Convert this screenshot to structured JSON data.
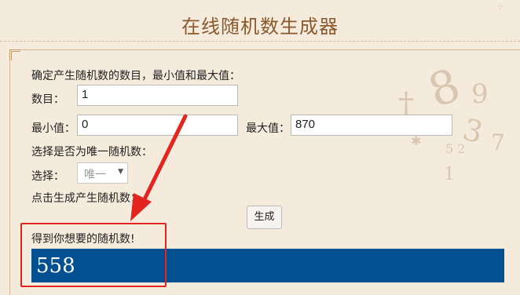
{
  "page": {
    "title": "在线随机数生成器"
  },
  "form": {
    "intro": "确定产生随机数的数目，最小值和最大值：",
    "count_label": "数目：",
    "count_value": "1",
    "min_label": "最小值：",
    "min_value": "0",
    "max_label": "最大值：",
    "max_value": "870",
    "unique_prompt": "选择是否为唯一随机数：",
    "select_label": "选择：",
    "select_value": "唯一",
    "click_prompt": "点击生成产生随机数：",
    "generate_button": "生成"
  },
  "result": {
    "label": "得到你想要的随机数!",
    "value": "558"
  },
  "colors": {
    "background": "#f5ebdd",
    "title": "#8a5a2e",
    "result_bar": "#02508f",
    "annotation": "#e4251f"
  },
  "icons": {
    "select_arrow": "chevron-down-icon",
    "annotation_arrow": "red-arrow-icon",
    "decoration": "number-watermark-decoration"
  }
}
